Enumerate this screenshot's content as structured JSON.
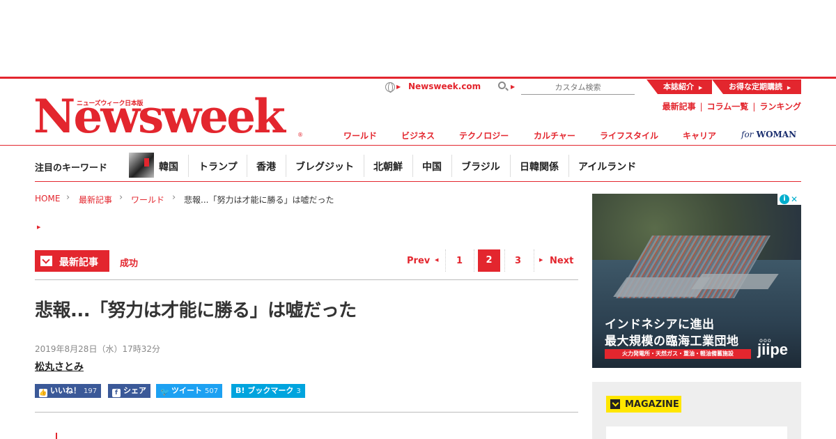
{
  "header": {
    "logo_subtitle": "ニューズウィーク日本版",
    "logo": "Newsweek",
    "logo_reg": "®",
    "newsweek_link": "Newsweek.com",
    "search_placeholder": "カスタム検索",
    "btn_about": "本誌紹介",
    "btn_subscribe": "お得な定期購読",
    "utility": [
      "最新記事",
      "コラム一覧",
      "ランキング"
    ],
    "nav": [
      "ワールド",
      "ビジネス",
      "テクノロジー",
      "カルチャー",
      "ライフスタイル",
      "キャリア"
    ],
    "for_woman_for": "for",
    "for_woman_text": "WOMAN"
  },
  "keywords": {
    "label": "注目のキーワード",
    "items": [
      "韓国",
      "トランプ",
      "香港",
      "ブレグジット",
      "北朝鮮",
      "中国",
      "ブラジル",
      "日韓関係",
      "アイルランド"
    ]
  },
  "breadcrumb": [
    "HOME",
    "最新記事",
    "ワールド"
  ],
  "breadcrumb_current": "悲報...「努力は才能に勝る」は嘘だった",
  "section": {
    "badge": "最新記事",
    "category": "成功"
  },
  "pagination": {
    "prev": "Prev",
    "pages": [
      "1",
      "2",
      "3"
    ],
    "current": "2",
    "next": "Next"
  },
  "article": {
    "title": "悲報...「努力は才能に勝る」は嘘だった",
    "date": "2019年8月28日（水）17時32分",
    "author": "松丸さとみ"
  },
  "social": {
    "like_label": "いいね！",
    "like_count": "197",
    "share_label": "シェア",
    "tweet_label": "ツイート",
    "tweet_count": "507",
    "bookmark_label": "ブックマーク",
    "bookmark_count": "3"
  },
  "ad": {
    "line1": "インドネシアに進出",
    "line2": "最大規模の臨海工業団地",
    "strip": "火力発電所・天然ガス・重油・軽油備蓄施設",
    "logo": "jiipe",
    "logo_dots": "ooo",
    "info": "i",
    "close": "✕"
  },
  "magazine": {
    "label": "MAGAZINE"
  },
  "colors": {
    "brand_red": "#e3262e",
    "facebook": "#3b5998",
    "twitter": "#1da1f2",
    "hatena": "#00a4de",
    "magazine_yellow": "#ffe600"
  }
}
